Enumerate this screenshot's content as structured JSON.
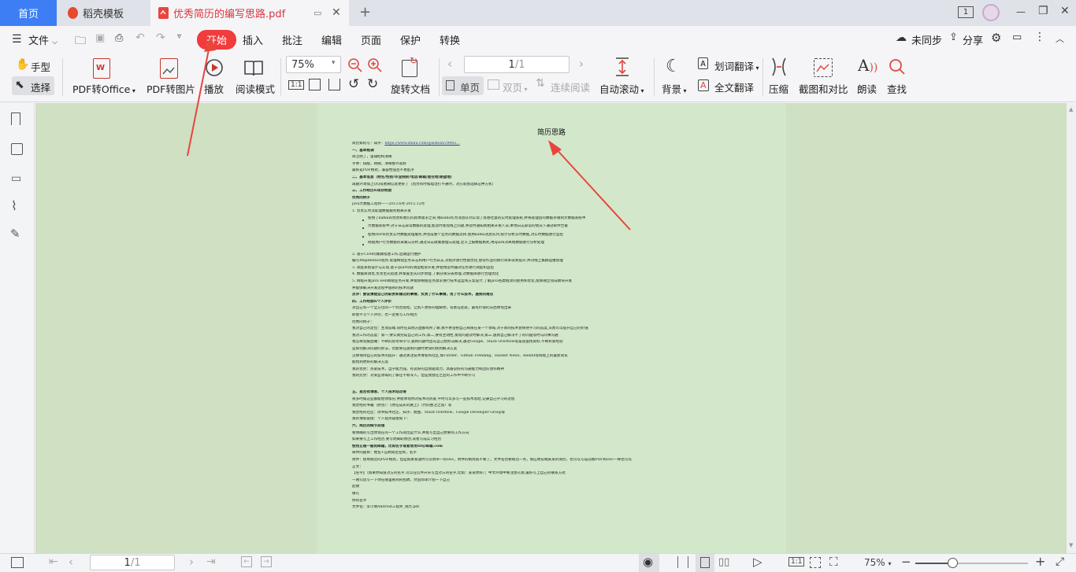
{
  "tabs": {
    "home": "首页",
    "template": "稻壳模板",
    "document": "优秀简历的编写思路.pdf",
    "page_badge": "1"
  },
  "menu": {
    "file": "文件",
    "items": [
      "开始",
      "插入",
      "批注",
      "编辑",
      "页面",
      "保护",
      "转换"
    ],
    "sync": "未同步",
    "share": "分享"
  },
  "toolbar": {
    "hand": "手型",
    "select": "选择",
    "pdf_to_office": "PDF转Office",
    "pdf_to_image": "PDF转图片",
    "play": "播放",
    "read_mode": "阅读模式",
    "zoom": "75%",
    "rotate": "旋转文档",
    "page_input": "1",
    "page_total": "/1",
    "single": "单页",
    "double": "双页",
    "continuous": "连续阅读",
    "auto_scroll": "自动滚动",
    "background": "背景",
    "word_translate": "划词翻译",
    "full_translate": "全文翻译",
    "compress": "压缩",
    "screenshot_compare": "截图和对比",
    "read_aloud": "朗读",
    "find": "查找"
  },
  "document": {
    "title": "简历思路",
    "lines": [
      {
        "t": "简历如何写：知乎：",
        "s": "n",
        "link": "https://www.zhihu.com/question/29002..."
      },
      {
        "t": "一、基本格调",
        "s": "b"
      },
      {
        "t": "简洁明了，逻辑结构清晰",
        "s": "n"
      },
      {
        "t": "字体：排版，稍微，清晰整齐就好",
        "s": "n"
      },
      {
        "t": "最好是PDF格式，兼容性强且不易乱序",
        "s": "n"
      },
      {
        "t": "二、基本信息（姓名/性别/毕业院校/电话/邮箱/居住地/期望地）",
        "s": "b"
      },
      {
        "t": "再额外添加上QQ或者微信就更好了（因为有时候电话打不通时，对方就会选择这种方式）",
        "s": "n"
      },
      {
        "t": "三、工作经历&项目经验",
        "s": "b"
      },
      {
        "t": "优秀的例子",
        "s": "b"
      },
      {
        "t": "java大数据工程师——2013.6月-2015.12月",
        "s": "n"
      },
      {
        "t": "1. 负责实时流处理数据服务相关开发",
        "s": "n"
      },
      {
        "t": "使用了kafka的优势和我们的具体需求之间,用kafka作为消息队列实现了高吞吐量的实时处理系统,并将处理后的数据存储到大数据系统中",
        "s": "bullet"
      },
      {
        "t": "大数据系统中,对于日志异常数据的处理,能及时发现线上问题,并及时通知到相关开发人员,本地日志异常的情况下通过邮件告警",
        "s": "bullet"
      },
      {
        "t": "使用storm负责实时数据处理服务,并完成整个业务的数据流转,使用kafka消息队列,统计分析实时数据,对实时数据进行监控",
        "s": "bullet"
      },
      {
        "t": "网站用户行为数据的采集与分析,通过日志收集整理与处理,定义上报数据格式,用spark对离线数据进行分析处理",
        "s": "bullet"
      },
      {
        "t": "2. 基于CDH的集群搭建工作,后期运行维护",
        "s": "n"
      },
      {
        "t": "编写MapReduce程序,处理网站业务日志和用户行为日志,对程序进行性能优化,使得作业的执行效率得到提升,并对线上集群运维管理",
        "s": "n"
      },
      {
        "t": "3. 调度系统设计与实现,基于quartz的调度框架开发,并使用定时器对任务进行调度和监控",
        "s": "n"
      },
      {
        "t": "4. 数据库调优,负责主从搭建,并掌握主从同步原理,了解分库分表原理,对数据库进行合理优化",
        "s": "n"
      },
      {
        "t": "5. 网站开发java web网站业务开发,并能够根据业务需求进行技术选型和方案设计,了解java各类框架的使用和优化,能够独立完成模块开发",
        "s": "n"
      },
      {
        "t": "并能够解决开发过程中遇到的技术问题",
        "s": "n"
      },
      {
        "t": "点评：要说清楚自己的职责和做过的事情，负责了什么事情，用了什么技术，遇到的难点",
        "s": "b"
      },
      {
        "t": "四、工作经验&个人评价",
        "s": "b"
      },
      {
        "t": "对自己有一个全方位的一个综合总结，让别人更好的理解你，或者在此处，最有价值的东西体现出来",
        "s": "n"
      },
      {
        "t": "即使不写个人评价，也一定要写工作经历",
        "s": "n"
      },
      {
        "t": "优秀的例子：",
        "s": "n"
      },
      {
        "t": "我对自己的定位：主攻前端,同时在其他方面都有所了解,我不希望把自己局限在某一个领域,对于新的技术会保持学习的态度,从而可以提升自己的价值",
        "s": "n"
      },
      {
        "t": "我对工作的态度：第一,要认真完成自己的工作;第二,要有主动性,发现问题及时解决;第三,遇到自己解决不了的问题及时与同事沟通",
        "s": "n"
      },
      {
        "t": "我怎样克服困难：不断的思考和学习,遇到问题时首先自己想办法解决,通过Google、Stack Overflow等渠道查找资料,不断积累经验",
        "s": "n"
      },
      {
        "t": "是如何解决问题的办法，也能够在遇到问题时更快的找到解决方案",
        "s": "n"
      },
      {
        "t": "怎样保持自己的技术的提升：通过关注技术博客和社区,如Twitter、Github Trending、Hacker News、Reddit等网站上的最新资讯",
        "s": "n"
      },
      {
        "t": "能找到更好的解决方案",
        "s": "n"
      },
      {
        "t": "我的优势：热爱技术，自学能力强，有良好的自我驱动力，具备良好的沟通能力和团队协作精神",
        "s": "n"
      },
      {
        "t": "我的劣势：对某些领域的了解还不够深入，但是我会在之后的工作中不断学习",
        "s": "n"
      },
      {
        "t": "",
        "s": "gap"
      },
      {
        "t": "五、是否有博客、个人技术站点等",
        "s": "b"
      },
      {
        "t": "很多时候这些都能给你加分,并能体现你对技术的热爱,平时可以多写一些技术总结,记录自己学习的过程",
        "s": "n"
      },
      {
        "t": "我曾经的书籍（原创）：《你在成长的路上》（代码整洁之道）等",
        "s": "n"
      },
      {
        "t": "我曾经的社区：简书技术社区、知乎、掘金、Stack Overflow、Google Developer Group等",
        "s": "n"
      },
      {
        "t": "我的博客链接：个人站点链接如下：",
        "s": "n"
      },
      {
        "t": "六、简历的细节处理",
        "s": "b"
      },
      {
        "t": "要明确的写出你现在的一个工作岗位是什么,并能写出自己想要的工作方向",
        "s": "n"
      },
      {
        "t": "如果要写上工作经历,要写明离职原因,或者写成实习经历",
        "s": "n"
      },
      {
        "t": "使用正规一般的邮箱，比如名字或者常用ID@邮箱.com",
        "s": "b"
      },
      {
        "t": "邮件的题目：姓名+应聘岗位名称，名字",
        "s": "n"
      },
      {
        "t": "附件：使用规范的PDF格式，但是如果发送时可以附带一份Doc，附件的格式就不要了。文件名也要规范一点，如应聘前端某某的简历，也可以写成前端PDF和Doc一样也可以",
        "s": "n"
      },
      {
        "t": "正文：",
        "s": "n"
      },
      {
        "t": "【名字】（如果你知道对方的名字,可以在信件开头写出对方的名字,比如：某某你好）；中文环境中要注意礼貌,最好写上自己的联系方式",
        "s": "n"
      },
      {
        "t": "一两句话写一下你在哪里看到的招聘，然后简单介绍一下自己",
        "s": "n"
      },
      {
        "t": "此致",
        "s": "n"
      },
      {
        "t": "敬礼",
        "s": "n"
      },
      {
        "t": "你的名字",
        "s": "n"
      },
      {
        "t": "文件名：李小明Android工程师_简历.pdf",
        "s": "n"
      }
    ]
  },
  "statusbar": {
    "page_input": "1",
    "page_total": "/1",
    "zoom": "75%",
    "zoom_fraction": 0.33
  },
  "colors": {
    "accent": "#3d7ef5",
    "brand_red": "#f03c3c",
    "page_bg": "#d3e7ca",
    "viewer_bg": "#cfe0c3",
    "arrow": "#e8453c"
  }
}
